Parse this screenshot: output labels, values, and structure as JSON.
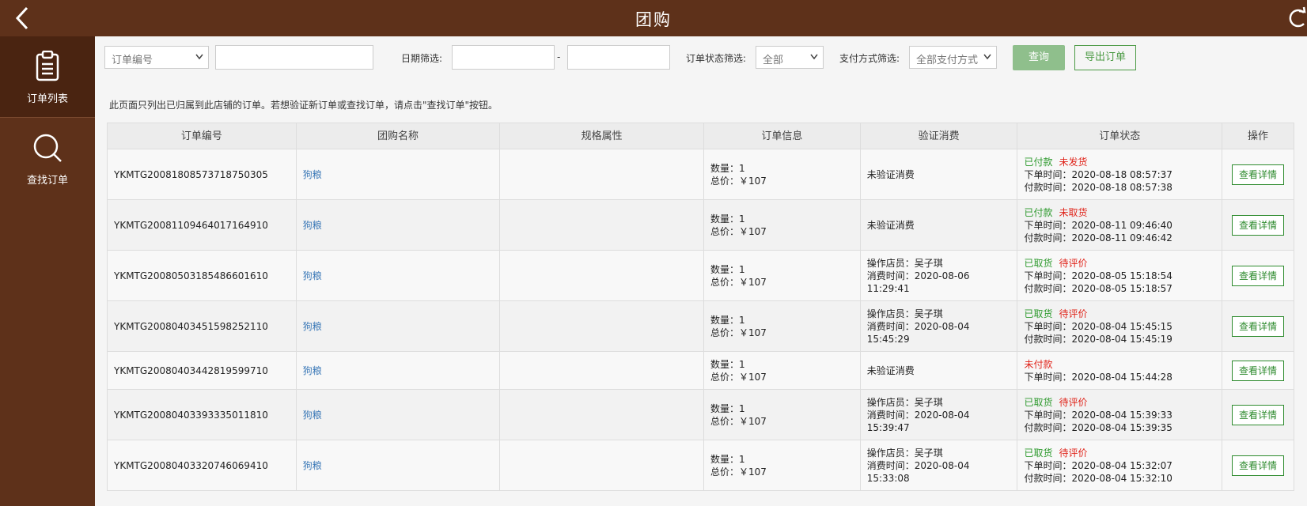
{
  "header": {
    "title": "团购"
  },
  "sidebar": {
    "items": [
      {
        "label": "订单列表",
        "icon": "clipboard-icon",
        "active": true
      },
      {
        "label": "查找订单",
        "icon": "search-icon",
        "active": false
      }
    ]
  },
  "filters": {
    "order_type_select": "订单编号",
    "order_number_value": "",
    "date_label": "日期筛选:",
    "date_separator": "-",
    "date_from": "",
    "date_to": "",
    "status_label": "订单状态筛选:",
    "status_select": "全部",
    "payment_label": "支付方式筛选:",
    "payment_select": "全部支付方式",
    "query_label": "查询",
    "export_label": "导出订单"
  },
  "notice": "此页面只列出已归属到此店铺的订单。若想验证新订单或查找订单，请点击\"查找订单\"按钮。",
  "table": {
    "headers": [
      "订单编号",
      "团购名称",
      "规格属性",
      "订单信息",
      "验证消费",
      "订单状态",
      "操作"
    ],
    "rows": [
      {
        "order_no": "YKMTG20081808573718750305",
        "name": "狗粮",
        "spec": "",
        "qty": "数量：1",
        "total": "总价：￥107",
        "verify": [
          "未验证消费"
        ],
        "pay_status": "已付款",
        "ship_status": "未发货",
        "order_time": "下单时间：2020-08-18 08:57:37",
        "pay_time": "付款时间：2020-08-18 08:57:38",
        "action": "查看详情"
      },
      {
        "order_no": "YKMTG20081109464017164910",
        "name": "狗粮",
        "spec": "",
        "qty": "数量：1",
        "total": "总价：￥107",
        "verify": [
          "未验证消费"
        ],
        "pay_status": "已付款",
        "ship_status": "未取货",
        "order_time": "下单时间：2020-08-11 09:46:40",
        "pay_time": "付款时间：2020-08-11 09:46:42",
        "action": "查看详情"
      },
      {
        "order_no": "YKMTG20080503185486601610",
        "name": "狗粮",
        "spec": "",
        "qty": "数量：1",
        "total": "总价：￥107",
        "verify": [
          "操作店员：吴子琪",
          "消费时间：2020-08-06 11:29:41"
        ],
        "pay_status": "已取货",
        "ship_status": "待评价",
        "order_time": "下单时间：2020-08-05 15:18:54",
        "pay_time": "付款时间：2020-08-05 15:18:57",
        "action": "查看详情"
      },
      {
        "order_no": "YKMTG20080403451598252110",
        "name": "狗粮",
        "spec": "",
        "qty": "数量：1",
        "total": "总价：￥107",
        "verify": [
          "操作店员：吴子琪",
          "消费时间：2020-08-04 15:45:29"
        ],
        "pay_status": "已取货",
        "ship_status": "待评价",
        "order_time": "下单时间：2020-08-04 15:45:15",
        "pay_time": "付款时间：2020-08-04 15:45:19",
        "action": "查看详情"
      },
      {
        "order_no": "YKMTG20080403442819599710",
        "name": "狗粮",
        "spec": "",
        "qty": "数量：1",
        "total": "总价：￥107",
        "verify": [
          "未验证消费"
        ],
        "pay_status": "未付款",
        "ship_status": "",
        "order_time": "下单时间：2020-08-04 15:44:28",
        "pay_time": "",
        "action": "查看详情"
      },
      {
        "order_no": "YKMTG20080403393335011810",
        "name": "狗粮",
        "spec": "",
        "qty": "数量：1",
        "total": "总价：￥107",
        "verify": [
          "操作店员：吴子琪",
          "消费时间：2020-08-04 15:39:47"
        ],
        "pay_status": "已取货",
        "ship_status": "待评价",
        "order_time": "下单时间：2020-08-04 15:39:33",
        "pay_time": "付款时间：2020-08-04 15:39:35",
        "action": "查看详情"
      },
      {
        "order_no": "YKMTG20080403320746069410",
        "name": "狗粮",
        "spec": "",
        "qty": "数量：1",
        "total": "总价：￥107",
        "verify": [
          "操作店员：吴子琪",
          "消费时间：2020-08-04 15:33:08"
        ],
        "pay_status": "已取货",
        "ship_status": "待评价",
        "order_time": "下单时间：2020-08-04 15:32:07",
        "pay_time": "付款时间：2020-08-04 15:32:10",
        "action": "查看详情"
      }
    ]
  },
  "colors": {
    "brand": "#5e311a",
    "paid": "#2e9a2e",
    "alert": "#e0251b",
    "link": "#3d7ab8"
  }
}
